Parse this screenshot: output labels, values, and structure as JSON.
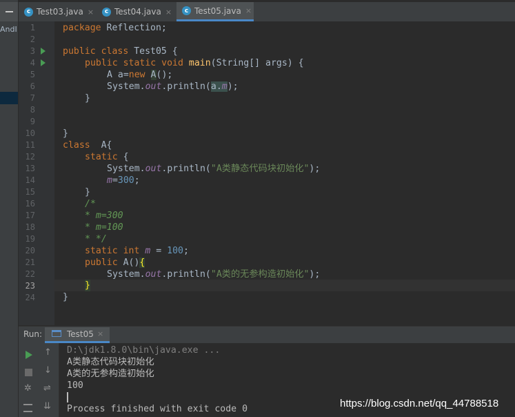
{
  "sidebar": {
    "project_label": "AndI"
  },
  "tabs": [
    {
      "label": "Test03.java",
      "close": "×"
    },
    {
      "label": "Test04.java",
      "close": "×"
    },
    {
      "label": "Test05.java",
      "close": "×"
    }
  ],
  "tab_icon_letter": "c",
  "editor": {
    "line_numbers": [
      "1",
      "2",
      "3",
      "4",
      "5",
      "6",
      "7",
      "8",
      "9",
      "10",
      "11",
      "12",
      "13",
      "14",
      "15",
      "16",
      "17",
      "18",
      "19",
      "20",
      "21",
      "22",
      "23",
      "24"
    ],
    "current_line": 23,
    "code": {
      "l1_kw": "package",
      "l1_rest": " Reflection;",
      "l3_kw": "public class",
      "l3_rest": " Test05 {",
      "l4_kw": "public static void",
      "l4_fn": "main",
      "l4_rest": "(String[] args) {",
      "l5_a": "A a=",
      "l5_kw": "new",
      "l5_cls": "A",
      "l5_rest": "();",
      "l6_a": "System.",
      "l6_out": "out",
      "l6_b": ".println(",
      "l6_hl": "a.",
      "l6_m": "m",
      "l6_rest": ");",
      "l7": "}",
      "l10": "}",
      "l11_kw": "class",
      "l11_rest": "  A{",
      "l12_kw": "static",
      "l12_rest": " {",
      "l13_a": "System.",
      "l13_out": "out",
      "l13_b": ".println(",
      "l13_str": "\"A类静态代码块初始化\"",
      "l13_rest": ");",
      "l14_m": "m",
      "l14_eq": "=",
      "l14_num": "300",
      "l14_rest": ";",
      "l15": "}",
      "l16": "/*",
      "l17": "* m=300",
      "l18": "* m=100",
      "l19": "* */",
      "l20_kw": "static int",
      "l20_m": "m",
      "l20_eq": " = ",
      "l20_num": "100",
      "l20_rest": ";",
      "l21_kw": "public",
      "l21_rest": " A()",
      "l21_brace": "{",
      "l22_a": "System.",
      "l22_out": "out",
      "l22_b": ".println(",
      "l22_str": "\"A类的无参构造初始化\"",
      "l22_rest": ");",
      "l23": "}",
      "l24": "}"
    }
  },
  "run_panel": {
    "label": "Run:",
    "tab_label": "Test05",
    "tab_close": "×",
    "console_lines": [
      "D:\\jdk1.8.0\\bin\\java.exe ...",
      "A类静态代码块初始化",
      "A类的无参构造初始化",
      "100",
      "",
      "Process finished with exit code 0"
    ]
  },
  "watermark": "https://blog.csdn.net/qq_44788518",
  "colors": {
    "keyword": "#cc7832",
    "string": "#6a8759",
    "number": "#6897bb",
    "function": "#ffc66d",
    "static_field": "#9876aa",
    "comment": "#629755",
    "run_icon": "#499c54",
    "tab_icon": "#3592c4"
  }
}
